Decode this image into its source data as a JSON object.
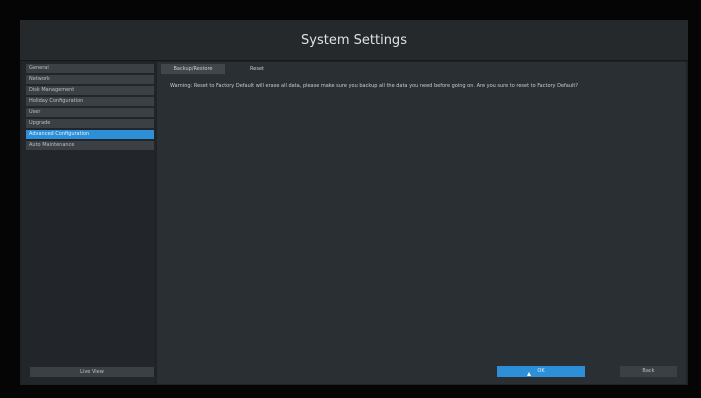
{
  "window": {
    "title": "System Settings"
  },
  "sidebar": {
    "items": [
      {
        "label": "General",
        "active": false
      },
      {
        "label": "Network",
        "active": false
      },
      {
        "label": "Disk Management",
        "active": false
      },
      {
        "label": "Holiday Configuration",
        "active": false
      },
      {
        "label": "User",
        "active": false
      },
      {
        "label": "Upgrade",
        "active": false
      },
      {
        "label": "Advanced Configuration",
        "active": true
      },
      {
        "label": "Auto Maintenance",
        "active": false
      }
    ],
    "live_view_label": "Live View"
  },
  "main": {
    "tabs": [
      {
        "label": "Backup/Restore",
        "selected": true
      },
      {
        "label": "Reset",
        "selected": false
      }
    ],
    "warning_text": "Warning: Reset to Factory Default will erase all data, please make sure you backup all the data you need before going on. Are you sure to reset to Factory Default?",
    "ok_label": "OK",
    "back_label": "Back"
  },
  "colors": {
    "accent": "#2c8fd8",
    "background": "#1f2326",
    "panel": "#2a2f33"
  }
}
